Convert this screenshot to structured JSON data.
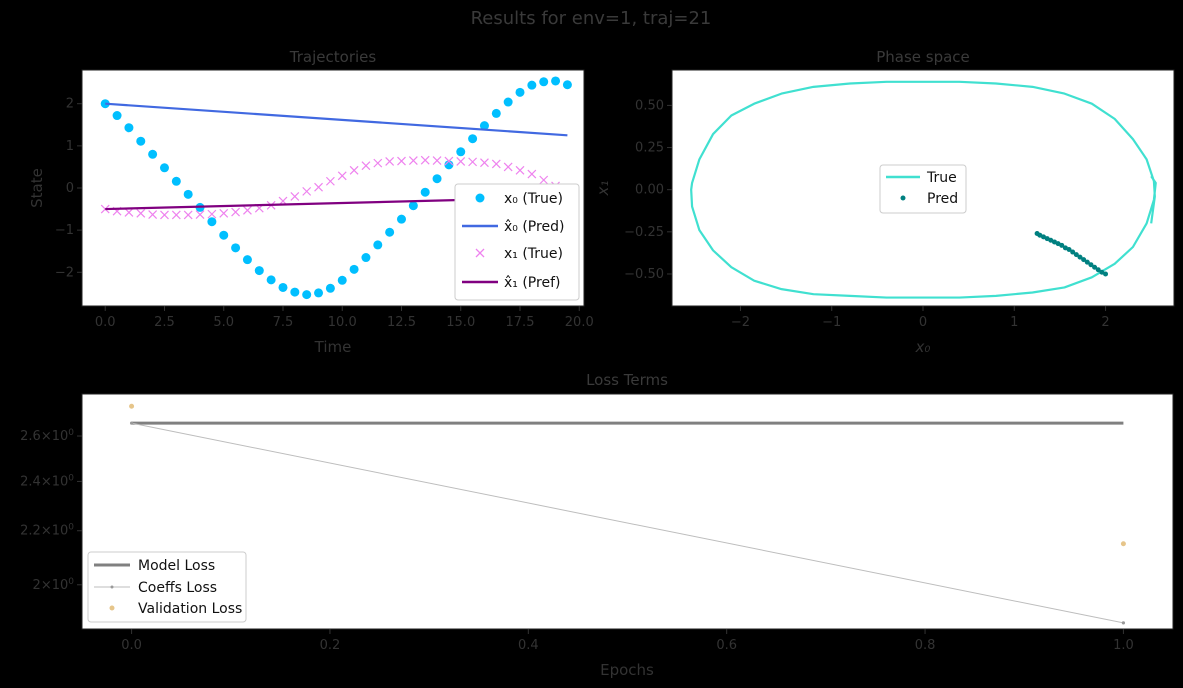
{
  "figure": {
    "suptitle": "Results for env=1, traj=21"
  },
  "chart_data": [
    {
      "id": "trajectories",
      "type": "line",
      "title": "Trajectories",
      "xlabel": "Time",
      "ylabel": "State",
      "xlim": [
        -0.98,
        20.2
      ],
      "ylim": [
        -2.8,
        2.8
      ],
      "xticks": [
        0,
        2.5,
        5,
        7.5,
        10,
        12.5,
        15,
        17.5,
        20
      ],
      "xtick_labels": [
        "0.0",
        "2.5",
        "5.0",
        "7.5",
        "10.0",
        "12.5",
        "15.0",
        "17.5",
        "20.0"
      ],
      "yticks": [
        -2,
        -1,
        0,
        1,
        2
      ],
      "ytick_labels": [
        "−2",
        "−1",
        "0",
        "1",
        "2"
      ],
      "legend_position": "lower-right",
      "series": [
        {
          "name": "x0_true",
          "legend": "x₀ (True)",
          "marker": "circle",
          "color": "#00BFFF",
          "x": [
            0,
            0.5,
            1,
            1.5,
            2,
            2.5,
            3,
            3.5,
            4,
            4.5,
            5,
            5.5,
            6,
            6.5,
            7,
            7.5,
            8,
            8.5,
            9,
            9.5,
            10,
            10.5,
            11,
            11.5,
            12,
            12.5,
            13,
            13.5,
            14,
            14.5,
            15,
            15.5,
            16,
            16.5,
            17,
            17.5,
            18,
            18.5,
            19,
            19.5
          ],
          "y": [
            2.0,
            1.72,
            1.43,
            1.11,
            0.8,
            0.48,
            0.16,
            -0.15,
            -0.46,
            -0.8,
            -1.12,
            -1.42,
            -1.7,
            -1.96,
            -2.18,
            -2.36,
            -2.47,
            -2.53,
            -2.49,
            -2.38,
            -2.19,
            -1.93,
            -1.65,
            -1.35,
            -1.05,
            -0.74,
            -0.42,
            -0.1,
            0.22,
            0.55,
            0.86,
            1.17,
            1.48,
            1.77,
            2.04,
            2.27,
            2.44,
            2.52,
            2.54,
            2.45
          ]
        },
        {
          "name": "x0_pred",
          "legend": "x̂₀ (Pred)",
          "marker": "line",
          "color": "#4169E1",
          "x": [
            0,
            19.5
          ],
          "y": [
            2.0,
            1.25
          ]
        },
        {
          "name": "x1_true",
          "legend": "x₁ (True)",
          "marker": "x",
          "color": "#EE82EE",
          "x": [
            0,
            0.5,
            1,
            1.5,
            2,
            2.5,
            3,
            3.5,
            4,
            4.5,
            5,
            5.5,
            6,
            6.5,
            7,
            7.5,
            8,
            8.5,
            9,
            9.5,
            10,
            10.5,
            11,
            11.5,
            12,
            12.5,
            13,
            13.5,
            14,
            14.5,
            15,
            15.5,
            16,
            16.5,
            17,
            17.5,
            18,
            18.5,
            19,
            19.5
          ],
          "y": [
            -0.5,
            -0.55,
            -0.58,
            -0.6,
            -0.63,
            -0.64,
            -0.64,
            -0.64,
            -0.63,
            -0.62,
            -0.6,
            -0.57,
            -0.53,
            -0.48,
            -0.41,
            -0.31,
            -0.2,
            -0.08,
            0.02,
            0.16,
            0.29,
            0.42,
            0.53,
            0.59,
            0.63,
            0.64,
            0.65,
            0.66,
            0.65,
            0.64,
            0.63,
            0.62,
            0.6,
            0.57,
            0.5,
            0.42,
            0.33,
            0.19,
            0.05,
            -0.04
          ]
        },
        {
          "name": "x1_pred",
          "legend": "x̂₁ (Pref)",
          "marker": "line",
          "color": "#800080",
          "x": [
            0,
            19.5
          ],
          "y": [
            -0.5,
            -0.22
          ]
        }
      ]
    },
    {
      "id": "phase_space",
      "type": "line",
      "title": "Phase space",
      "xlabel": "x₀",
      "ylabel": "x₁",
      "xlim": [
        -2.75,
        2.75
      ],
      "ylim": [
        -0.69,
        0.71
      ],
      "xticks": [
        -2,
        -1,
        0,
        1,
        2
      ],
      "xtick_labels": [
        "−2",
        "−1",
        "0",
        "1",
        "2"
      ],
      "yticks": [
        -0.5,
        -0.25,
        0,
        0.25,
        0.5
      ],
      "ytick_labels": [
        "−0.50",
        "−0.25",
        "0.00",
        "0.25",
        "0.50"
      ],
      "legend_position": "center",
      "series": [
        {
          "name": "true",
          "legend": "True",
          "marker": "line",
          "color": "#40E0D0",
          "x": [
            2.5,
            2.54,
            2.53,
            2.45,
            2.3,
            2.1,
            1.85,
            1.55,
            1.2,
            0.8,
            0.4,
            0.0,
            -0.4,
            -0.8,
            -1.2,
            -1.55,
            -1.85,
            -2.1,
            -2.3,
            -2.45,
            -2.53,
            -2.54,
            -2.53,
            -2.45,
            -2.3,
            -2.1,
            -1.85,
            -1.55,
            -1.2,
            -0.8,
            -0.4,
            0.0,
            0.4,
            0.8,
            1.2,
            1.55,
            1.85,
            2.1,
            2.3,
            2.45,
            2.53,
            2.55,
            2.5
          ],
          "y": [
            -0.2,
            -0.04,
            0.05,
            0.18,
            0.3,
            0.42,
            0.51,
            0.57,
            0.61,
            0.63,
            0.64,
            0.64,
            0.64,
            0.63,
            0.61,
            0.57,
            0.51,
            0.44,
            0.33,
            0.18,
            0.04,
            0.0,
            -0.1,
            -0.24,
            -0.36,
            -0.46,
            -0.54,
            -0.59,
            -0.62,
            -0.63,
            -0.64,
            -0.64,
            -0.64,
            -0.63,
            -0.61,
            -0.58,
            -0.52,
            -0.44,
            -0.34,
            -0.2,
            -0.06,
            0.04,
            0.08
          ]
        },
        {
          "name": "pred",
          "legend": "Pred",
          "marker": "dot",
          "color": "#008080",
          "x": [
            2.0,
            1.96,
            1.92,
            1.88,
            1.84,
            1.8,
            1.76,
            1.72,
            1.68,
            1.64,
            1.6,
            1.56,
            1.52,
            1.48,
            1.44,
            1.4,
            1.36,
            1.32,
            1.28,
            1.25
          ],
          "y": [
            -0.5,
            -0.49,
            -0.475,
            -0.46,
            -0.445,
            -0.43,
            -0.415,
            -0.4,
            -0.385,
            -0.37,
            -0.355,
            -0.345,
            -0.33,
            -0.32,
            -0.31,
            -0.3,
            -0.29,
            -0.28,
            -0.27,
            -0.26
          ]
        }
      ]
    },
    {
      "id": "loss_terms",
      "type": "line",
      "title": "Loss Terms",
      "xlabel": "Epochs",
      "ylabel": "",
      "yscale": "log",
      "xlim": [
        -0.05,
        1.05
      ],
      "ylim": [
        1.85,
        2.8
      ],
      "xticks": [
        0,
        0.2,
        0.4,
        0.6,
        0.8,
        1.0
      ],
      "xtick_labels": [
        "0.0",
        "0.2",
        "0.4",
        "0.6",
        "0.8",
        "1.0"
      ],
      "yticks": [
        2.0,
        2.2,
        2.4,
        2.6
      ],
      "ytick_labels": [
        {
          "mant": "2",
          "base": "10",
          "exp": "0"
        },
        {
          "mant": "2.2",
          "base": "10",
          "exp": "0"
        },
        {
          "mant": "2.4",
          "base": "10",
          "exp": "0"
        },
        {
          "mant": "2.6",
          "base": "10",
          "exp": "0"
        }
      ],
      "legend_position": "lower-left",
      "series": [
        {
          "name": "model_loss",
          "legend": "Model Loss",
          "marker": "thick-line",
          "color": "#808080",
          "x": [
            0,
            1
          ],
          "y": [
            2.66,
            2.66
          ]
        },
        {
          "name": "coeffs_loss",
          "legend": "Coeffs Loss",
          "marker": "thin-line-dot",
          "color": "#BDBDBD",
          "x": [
            0,
            1
          ],
          "y": [
            2.66,
            1.87
          ]
        },
        {
          "name": "validation_loss",
          "legend": "Validation Loss",
          "marker": "dot",
          "color": "#E6C58A",
          "x": [
            0,
            1
          ],
          "y": [
            2.74,
            2.15
          ]
        }
      ]
    }
  ]
}
